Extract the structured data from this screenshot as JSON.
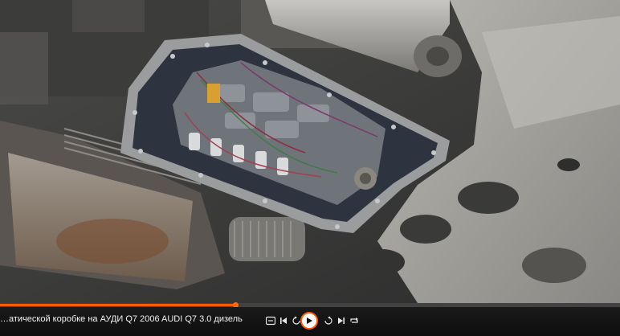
{
  "player": {
    "title": "…атической коробке на АУДИ Q7 2006 AUDI Q7 3.0 дизель",
    "progress": 0.38,
    "accent_color": "#ff5a00",
    "controls": {
      "icons": [
        "subtitles-icon",
        "skip-back-icon",
        "rewind-icon",
        "play-icon",
        "forward-icon",
        "skip-forward-icon",
        "repeat-icon"
      ]
    }
  }
}
